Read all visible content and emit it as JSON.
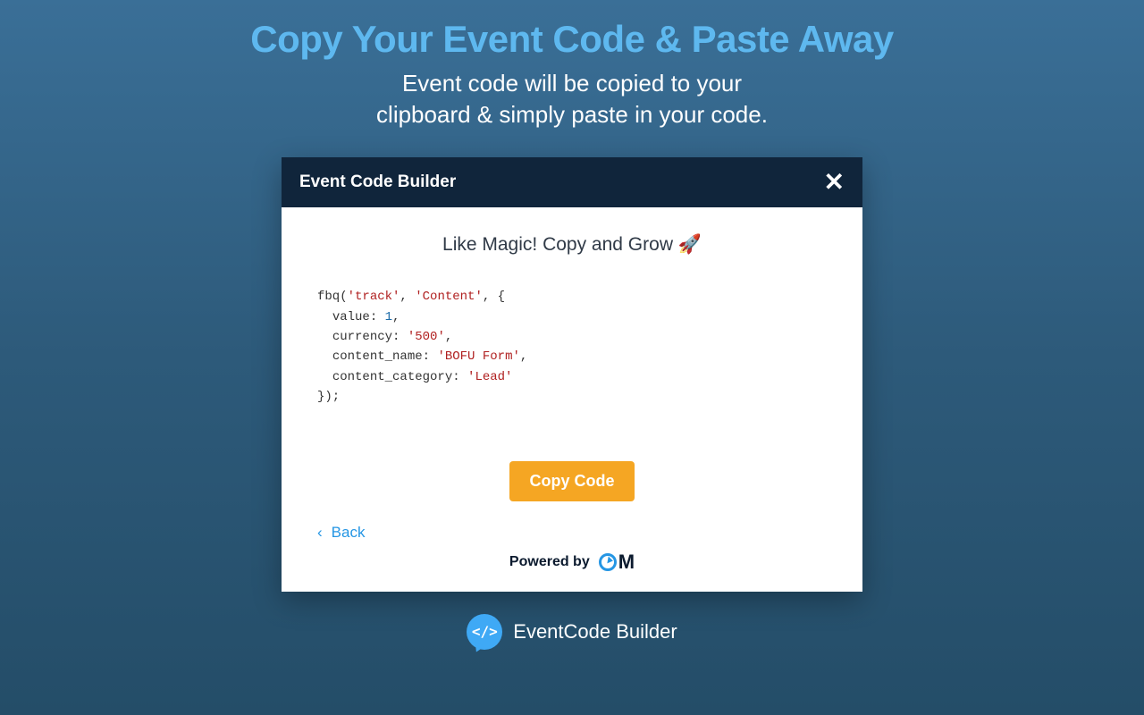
{
  "hero": {
    "title": "Copy Your Event Code & Paste Away",
    "subtitle_line1": "Event code will be copied to your",
    "subtitle_line2": "clipboard & simply paste in your code."
  },
  "modal": {
    "title": "Event Code Builder",
    "close_symbol": "✕",
    "magic_text": "Like Magic! Copy and Grow 🚀",
    "code": {
      "fn": "fbq(",
      "arg1": "'track'",
      "arg2": "'Content'",
      "open": ", {",
      "k_value": "value",
      "v_value": "1",
      "k_currency": "currency",
      "v_currency": "'500'",
      "k_content_name": "content_name",
      "v_content_name": "'BOFU Form'",
      "k_content_category": "content_category",
      "v_content_category": "'Lead'",
      "close": "});"
    },
    "copy_button": "Copy Code",
    "back_label": "Back",
    "back_chevron": "‹",
    "powered_by": "Powered by",
    "om_letter": "M"
  },
  "brand": {
    "name": "EventCode Builder",
    "icon_text": "</>"
  }
}
